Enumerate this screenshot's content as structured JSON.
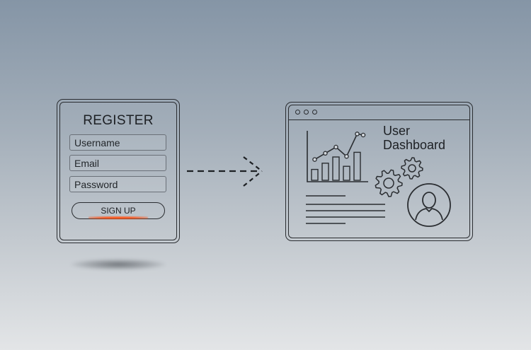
{
  "register": {
    "title": "REGISTER",
    "username_placeholder": "Username",
    "email_placeholder": "Email",
    "password_placeholder": "Password",
    "signup_label": "SIGN UP"
  },
  "dashboard": {
    "title_line1": "User",
    "title_line2": "Dashboard",
    "chart_bars_relative": [
      0.35,
      0.55,
      0.75,
      0.45,
      0.9
    ]
  },
  "icons": {
    "arrow": "dashed-arrow-right-icon",
    "chart": "bar-line-chart-icon",
    "gears": "gears-icon",
    "avatar": "user-avatar-icon",
    "window_dots": "window-control-dots"
  },
  "colors": {
    "line": "#2a2d31",
    "glow": "#ff5a1a",
    "background_top": "#8595a6",
    "background_bottom": "#e3e5e7"
  }
}
